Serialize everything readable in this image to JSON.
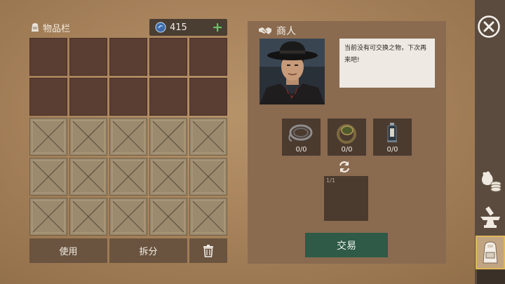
{
  "inventory": {
    "title": "物品栏",
    "currency_amount": "415",
    "currency_add": "+",
    "slots": [
      "open",
      "open",
      "open",
      "open",
      "open",
      "open",
      "open",
      "open",
      "open",
      "open",
      "locked",
      "locked",
      "locked",
      "locked",
      "locked",
      "locked",
      "locked",
      "locked",
      "locked",
      "locked",
      "locked",
      "locked",
      "locked",
      "locked",
      "locked"
    ],
    "use_label": "使用",
    "split_label": "拆分"
  },
  "merchant": {
    "name": "商人",
    "message": "当前没有可交换之物，下次再来吧!",
    "goods": [
      {
        "icon": "rope-icon",
        "count": "0/0"
      },
      {
        "icon": "ring-icon",
        "count": "0/0"
      },
      {
        "icon": "lantern-icon",
        "count": "0/0"
      }
    ],
    "result_count": "1/1",
    "trade_label": "交易"
  },
  "sidebar": {
    "items": [
      {
        "icon": "coins-pouch-icon",
        "active": false
      },
      {
        "icon": "anvil-icon",
        "active": false
      },
      {
        "icon": "backpack-icon",
        "active": true
      }
    ]
  },
  "colors": {
    "background": "#a7825b",
    "empty_slot": "#5a3d33",
    "locked_slot": "#9b8a6d",
    "trade_button": "#2e5a47",
    "plus": "#63c468"
  }
}
